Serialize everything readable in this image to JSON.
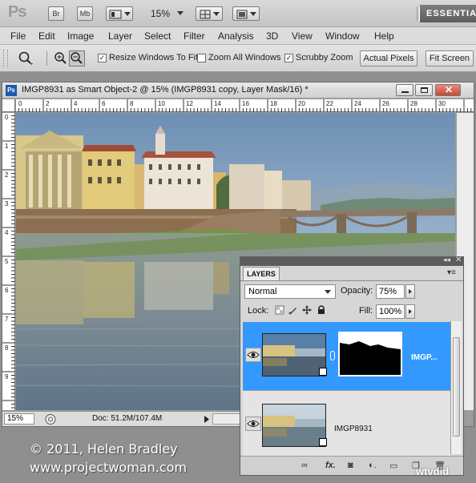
{
  "appbar": {
    "logo": "Ps",
    "bridge_label": "Br",
    "minibridge_label": "Mb",
    "zoom_value": "15%",
    "workspace": "ESSENTIA"
  },
  "menu": [
    "File",
    "Edit",
    "Image",
    "Layer",
    "Select",
    "Filter",
    "Analysis",
    "3D",
    "View",
    "Window",
    "Help"
  ],
  "options": {
    "resize_windows_label": "Resize Windows To Fit",
    "resize_windows_checked": true,
    "zoom_all_label": "Zoom All Windows",
    "zoom_all_checked": false,
    "scrubby_label": "Scrubby Zoom",
    "scrubby_checked": true,
    "actual_pixels_label": "Actual Pixels",
    "fit_screen_label": "Fit Screen"
  },
  "document": {
    "title": "IMGP8931 as Smart Object-2 @ 15% (IMGP8931 copy, Layer Mask/16) *",
    "zoom": "15%",
    "doc_size": "Doc: 51.2M/107.4M",
    "ruler_h": [
      "0",
      "2",
      "4",
      "6",
      "8",
      "10",
      "12",
      "14",
      "16",
      "18",
      "20",
      "22",
      "24",
      "26",
      "28",
      "30"
    ],
    "ruler_v": [
      "0",
      "1",
      "2",
      "3",
      "4",
      "5",
      "6",
      "7",
      "8",
      "9"
    ]
  },
  "layers_panel": {
    "tab": "LAYERS",
    "blend_mode": "Normal",
    "opacity_label": "Opacity:",
    "opacity_value": "75%",
    "lock_label": "Lock:",
    "fill_label": "Fill:",
    "fill_value": "100%",
    "layers": [
      {
        "name": "IMGP...",
        "selected": true,
        "has_mask": true
      },
      {
        "name": "IMGP8931",
        "selected": false,
        "has_mask": false
      }
    ],
    "footer_icons": [
      "link-icon",
      "fx-icon",
      "add-mask-icon",
      "adjustment-icon",
      "group-icon",
      "new-layer-icon",
      "trash-icon"
    ],
    "footer_fx": "fx."
  },
  "watermark": {
    "copyright": "© 2011, Helen Bradley",
    "site": "www.projectwoman.com",
    "badge": "wtvdid"
  },
  "colors": {
    "selection": "#3399ff",
    "workspace": "#8f8f8f"
  }
}
